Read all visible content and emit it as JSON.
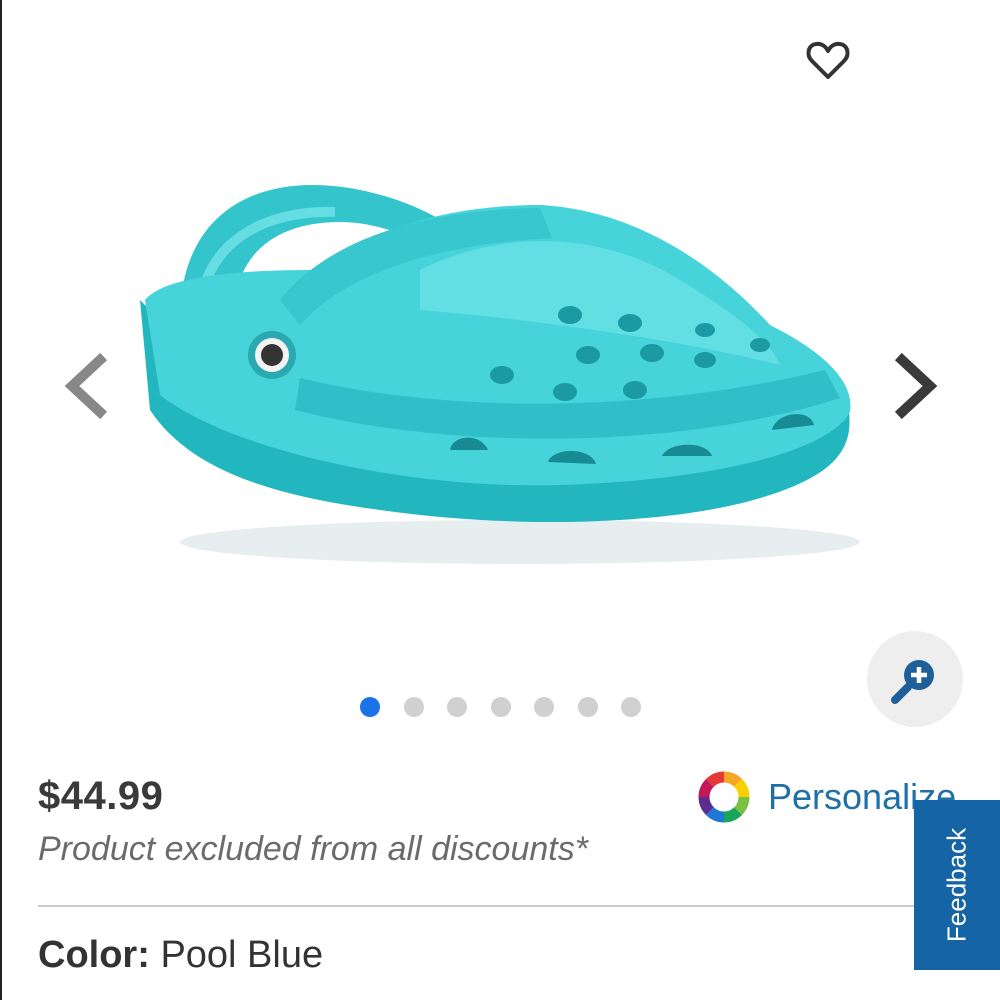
{
  "product": {
    "price": "$44.99",
    "discount_note": "Product excluded from all discounts*",
    "color_label": "Color:",
    "color_value": "Pool Blue",
    "image_name": "classic-clog-pool-blue"
  },
  "gallery": {
    "slide_count": 7,
    "active_slide": 1
  },
  "actions": {
    "personalize_label": "Personalize",
    "feedback_label": "Feedback"
  },
  "icons": {
    "wishlist": "heart-outline-icon",
    "prev": "chevron-left-icon",
    "next": "chevron-right-icon",
    "zoom": "zoom-in-icon",
    "personalize": "color-wheel-icon"
  },
  "colors": {
    "clog": "#3ccfd6",
    "active_dot": "#1a73e8",
    "personalize_link": "#1f6fa8",
    "feedback_tab": "#1565a6"
  }
}
